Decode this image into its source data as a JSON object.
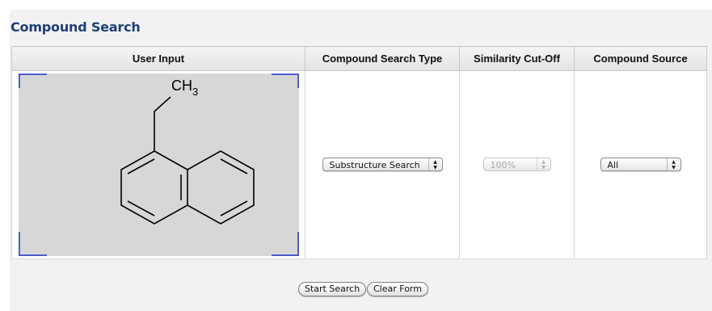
{
  "section_title": "Compound Search",
  "columns": [
    "User Input",
    "Compound Search Type",
    "Similarity Cut-Off",
    "Compound Source"
  ],
  "structure": {
    "label_main": "CH",
    "label_sub": "3"
  },
  "search_type": {
    "selected": "Substructure Search",
    "disabled": false
  },
  "similarity": {
    "selected": "100%",
    "disabled": true
  },
  "source": {
    "selected": "All",
    "disabled": false
  },
  "buttons": {
    "start": "Start Search",
    "clear": "Clear Form"
  },
  "colors": {
    "title": "#1f3f77",
    "canvas_corners": "#2233cc",
    "canvas_bg": "#d7d7d7"
  },
  "icons": {
    "select_arrow": "updown-arrows-icon"
  }
}
